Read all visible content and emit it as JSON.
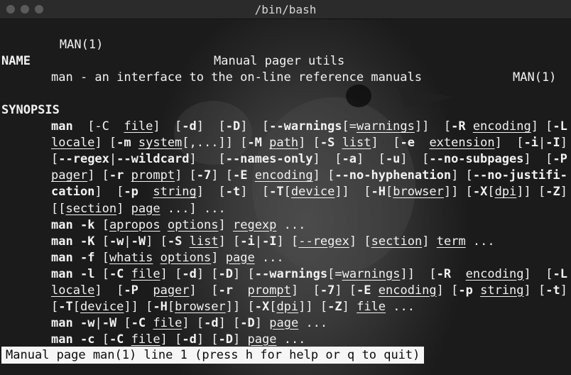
{
  "window": {
    "title": "/bin/bash"
  },
  "header": {
    "left": "MAN(1)",
    "center": "Manual pager utils",
    "right": "MAN(1)"
  },
  "name_section": {
    "heading": "NAME",
    "description": "man - an interface to the on-line reference manuals"
  },
  "synopsis_section": {
    "heading": "SYNOPSIS",
    "lines": [
      "man  [-C  file]  [-d]  [-D]  [--warnings[=warnings]]  [-R encoding] [-L",
      "locale] [-m system[,...]] [-M path] [-S list]  [-e  extension]  [-i|-I]",
      "[--regex|--wildcard]   [--names-only]  [-a]  [-u]  [--no-subpages]  [-P",
      "pager] [-r prompt] [-7] [-E encoding] [--no-hyphenation] [--no-justifi-",
      "cation]  [-p  string]  [-t]  [-T[device]]  [-H[browser]] [-X[dpi]] [-Z]",
      "[[section] page ...] ...",
      "man -k [apropos options] regexp ...",
      "man -K [-w|-W] [-S list] [-i|-I] [--regex] [section] term ...",
      "man -f [whatis options] page ...",
      "man -l [-C file] [-d] [-D] [--warnings[=warnings]]  [-R  encoding]  [-L",
      "locale]  [-P  pager]  [-r  prompt]  [-7] [-E encoding] [-p string] [-t]",
      "[-T[device]] [-H[browser]] [-X[dpi]] [-Z] file ...",
      "man -w|-W [-C file] [-d] [-D] page ...",
      "man -c [-C file] [-d] [-D] page ..."
    ]
  },
  "status": {
    "prompt": "Manual page man(1) line 1 (press h for help or q to quit)"
  }
}
